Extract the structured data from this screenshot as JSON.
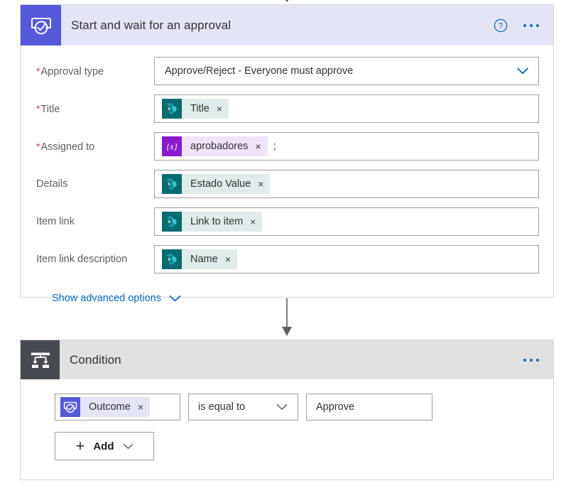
{
  "colors": {
    "approval_accent": "#5558d9",
    "approval_header_bg": "#e4e4f7",
    "condition_accent": "#484a52",
    "condition_header_bg": "#e1e1e1",
    "link_blue": "#0f6cbd",
    "required_red": "#d6394a",
    "sharepoint_teal": "#036c70",
    "variable_purple": "#8c18cf",
    "field_border": "#a19f9d"
  },
  "approval_card": {
    "icon_name": "approval-icon",
    "title": "Start and wait for an approval",
    "help_icon": "help-circle-icon",
    "more_icon": "ellipsis-icon",
    "fields": [
      {
        "label": "Approval type",
        "required": true,
        "kind": "dropdown",
        "value": "Approve/Reject - Everyone must approve",
        "chevron_icon": "chevron-down-icon"
      },
      {
        "label": "Title",
        "required": true,
        "kind": "token",
        "token": {
          "text": "Title",
          "source": "sharepoint",
          "icon_name": "sharepoint-icon",
          "remove_label": "×"
        }
      },
      {
        "label": "Assigned to",
        "required": true,
        "kind": "token",
        "token": {
          "text": "aprobadores",
          "source": "variable",
          "icon_name": "variable-icon",
          "icon_text": "{x}",
          "remove_label": "×"
        },
        "trailing_text": ";"
      },
      {
        "label": "Details",
        "required": false,
        "kind": "token",
        "token": {
          "text": "Estado Value",
          "source": "sharepoint",
          "icon_name": "sharepoint-icon",
          "remove_label": "×"
        }
      },
      {
        "label": "Item link",
        "required": false,
        "kind": "token",
        "token": {
          "text": "Link to item",
          "source": "sharepoint",
          "icon_name": "sharepoint-icon",
          "remove_label": "×"
        }
      },
      {
        "label": "Item link description",
        "required": false,
        "kind": "token",
        "token": {
          "text": "Name",
          "source": "sharepoint",
          "icon_name": "sharepoint-icon",
          "remove_label": "×"
        }
      }
    ],
    "advanced_options": {
      "label": "Show advanced options",
      "chevron_icon": "chevron-down-icon"
    }
  },
  "condition_card": {
    "icon_name": "condition-branch-icon",
    "title": "Condition",
    "more_icon": "ellipsis-icon",
    "row": {
      "left_token": {
        "text": "Outcome",
        "source": "approval",
        "icon_name": "approval-icon",
        "remove_label": "×"
      },
      "operator": "is equal to",
      "operator_chevron_icon": "chevron-down-icon",
      "value": "Approve"
    },
    "add_button": {
      "label": "Add",
      "plus_icon": "plus-icon",
      "chevron_icon": "chevron-down-icon"
    }
  }
}
